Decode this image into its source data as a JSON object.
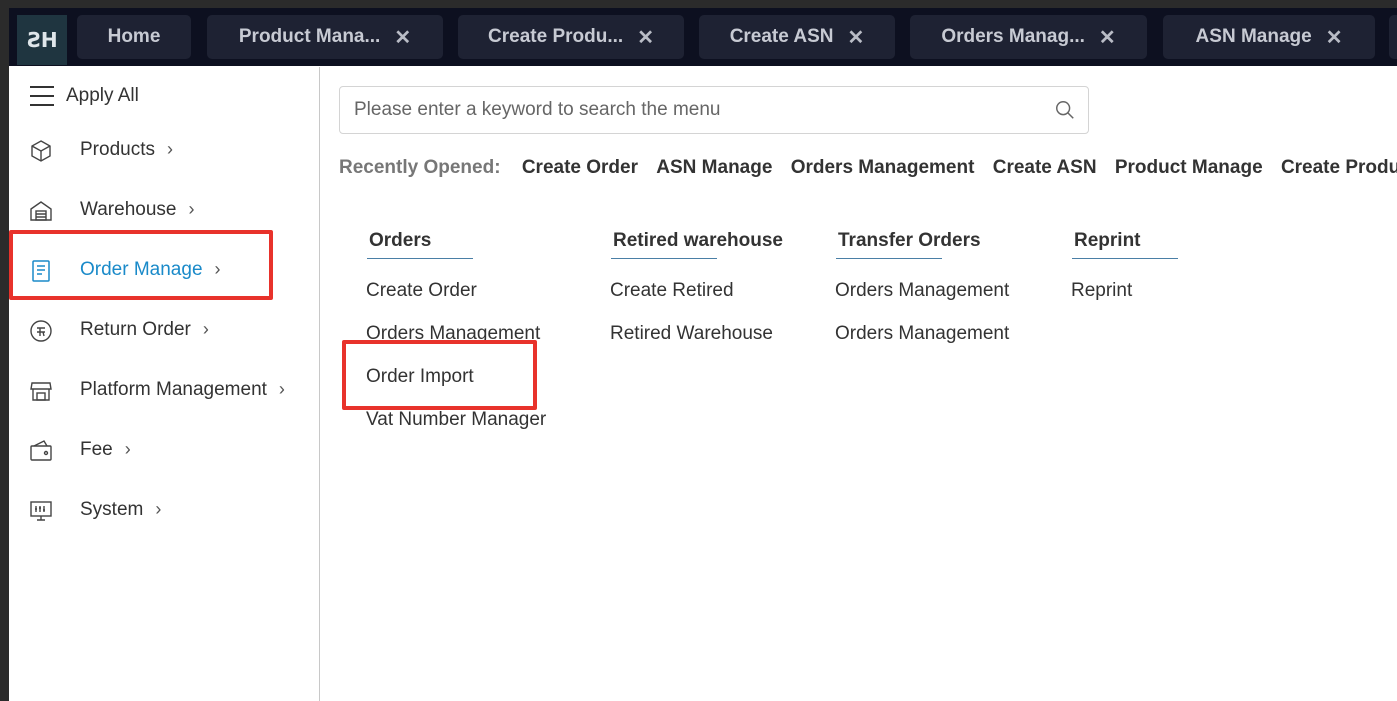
{
  "logo": {
    "text": "ƧH"
  },
  "tabs": [
    {
      "label": "Home",
      "closable": false
    },
    {
      "label": "Product Mana...",
      "closable": true
    },
    {
      "label": "Create Produ...",
      "closable": true
    },
    {
      "label": "Create ASN",
      "closable": true
    },
    {
      "label": "Orders Manag...",
      "closable": true
    },
    {
      "label": "ASN Manage",
      "closable": true
    }
  ],
  "close_glyph": "✕",
  "sidebar": {
    "apply_all": "Apply All",
    "chevron": "›",
    "items": [
      {
        "label": "Products",
        "icon": "cube-icon"
      },
      {
        "label": "Warehouse",
        "icon": "warehouse-icon"
      },
      {
        "label": "Order Manage",
        "icon": "document-icon",
        "active": true
      },
      {
        "label": "Return Order",
        "icon": "return-icon"
      },
      {
        "label": "Platform Management",
        "icon": "store-icon"
      },
      {
        "label": "Fee",
        "icon": "wallet-icon"
      },
      {
        "label": "System",
        "icon": "monitor-icon"
      }
    ]
  },
  "search": {
    "placeholder": "Please enter a keyword to search the menu",
    "value": ""
  },
  "recent": {
    "label": "Recently Opened:",
    "items": [
      "Create Order",
      "ASN Manage",
      "Orders Management",
      "Create ASN",
      "Product Manage",
      "Create Product"
    ]
  },
  "menu_columns": [
    {
      "title": "Orders",
      "links": [
        "Create Order",
        "Orders Management",
        "Order Import",
        "Vat Number Manager"
      ]
    },
    {
      "title": "Retired warehouse",
      "links": [
        "Create Retired",
        "Retired Warehouse"
      ]
    },
    {
      "title": "Transfer Orders",
      "links": [
        "Orders Management",
        "Orders Management"
      ]
    },
    {
      "title": "Reprint",
      "links": [
        "Reprint"
      ]
    }
  ],
  "colors": {
    "accent": "#1a8ac9",
    "highlight": "#e8322b",
    "topbar": "#0d1020",
    "tab": "#1e2233"
  }
}
